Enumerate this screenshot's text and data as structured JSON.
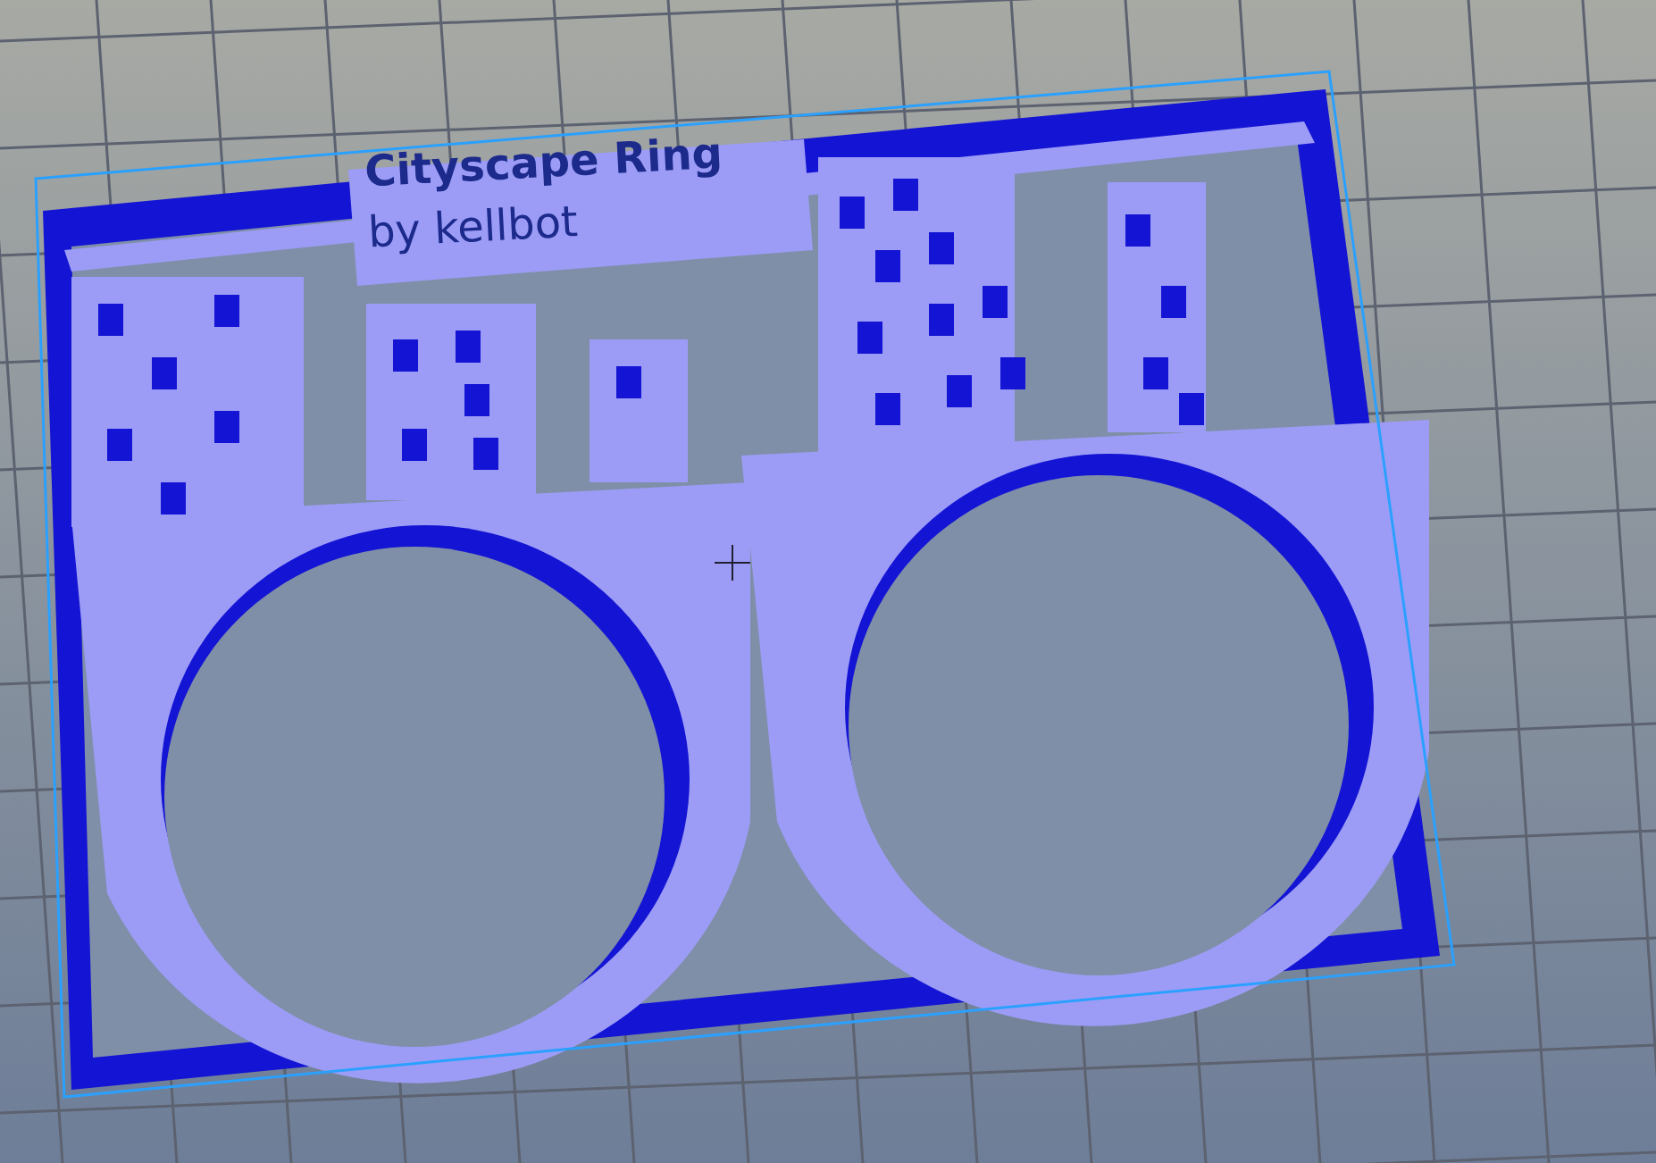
{
  "viewport": {
    "model_label": [
      "Cityscape Ring",
      "by kellbot"
    ]
  }
}
